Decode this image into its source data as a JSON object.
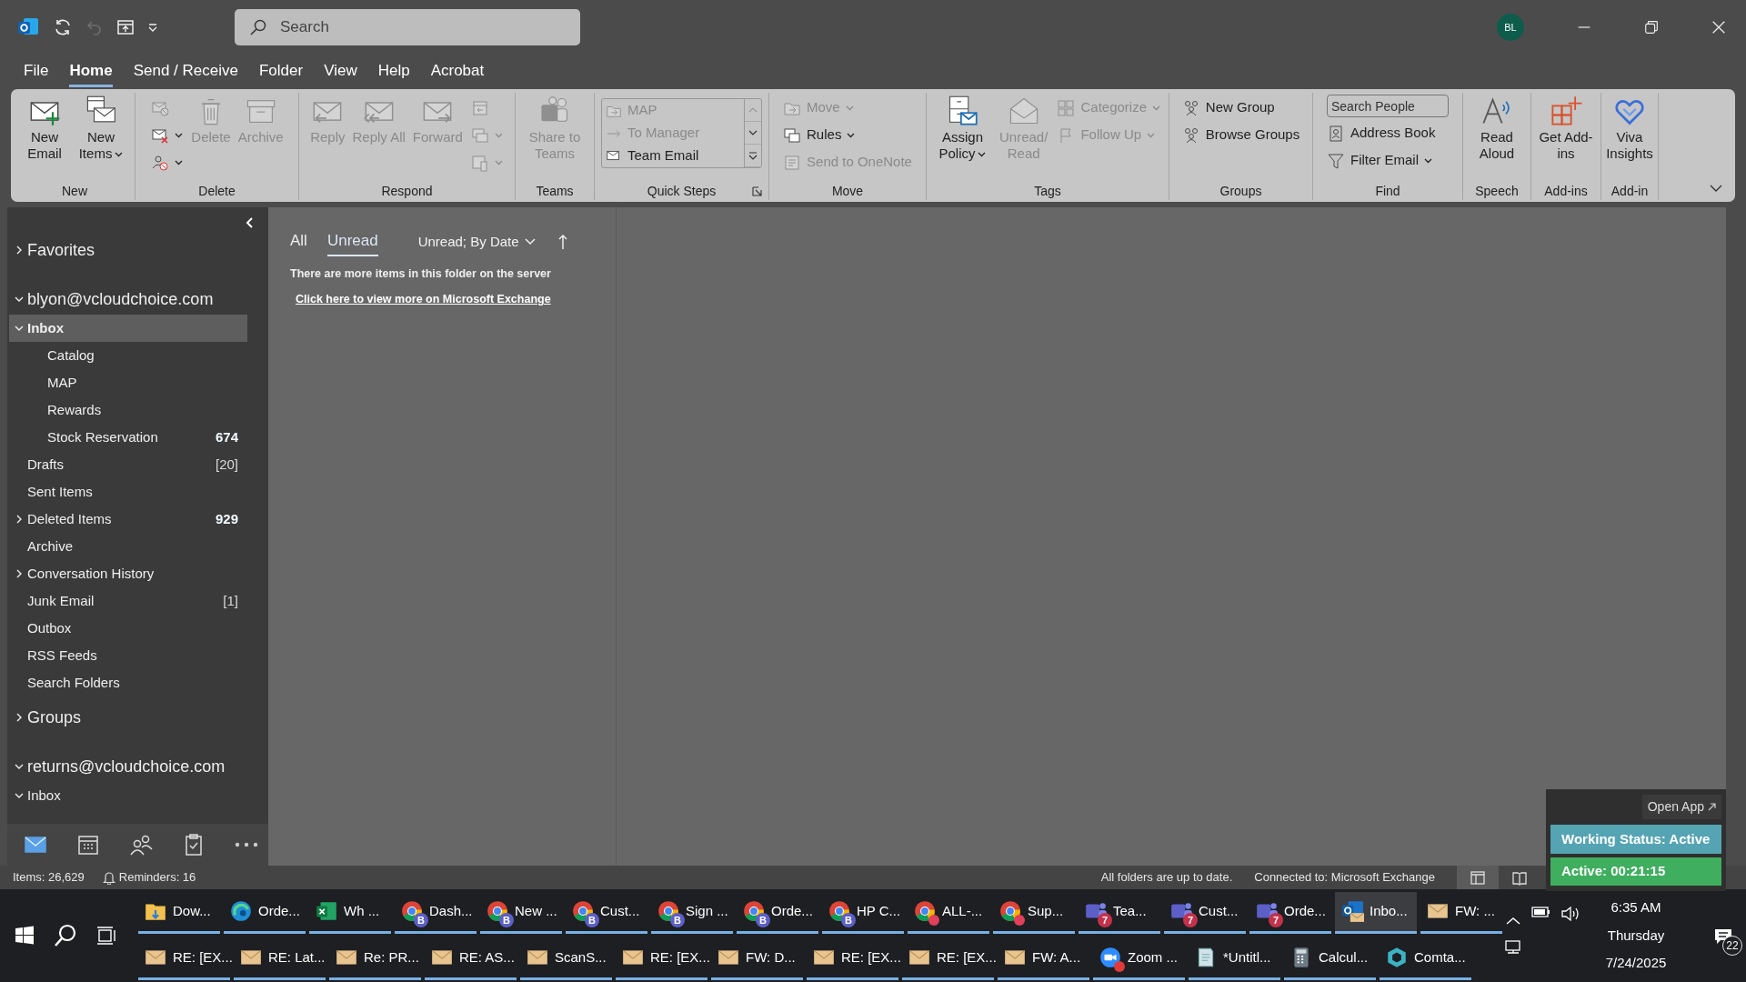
{
  "title_bar": {
    "search_placeholder": "Search",
    "avatar": "BL"
  },
  "menu_tabs": [
    {
      "label": "File",
      "selected": false
    },
    {
      "label": "Home",
      "selected": true
    },
    {
      "label": "Send / Receive",
      "selected": false
    },
    {
      "label": "Folder",
      "selected": false
    },
    {
      "label": "View",
      "selected": false
    },
    {
      "label": "Help",
      "selected": false
    },
    {
      "label": "Acrobat",
      "selected": false
    }
  ],
  "ribbon": {
    "groups": [
      {
        "label": "New",
        "launcher": false,
        "columns": [
          {
            "kind": "large",
            "label": "New Email",
            "disabled": false,
            "dropdown": false
          },
          {
            "kind": "large",
            "label": "New Items",
            "disabled": false,
            "dropdown": true
          }
        ]
      },
      {
        "label": "Delete",
        "launcher": false,
        "columns": [
          {
            "kind": "stack",
            "items": [
              {
                "disabled": true,
                "dropdown": false
              },
              {
                "disabled": false,
                "dropdown": true
              },
              {
                "disabled": false,
                "dropdown": true
              }
            ]
          },
          {
            "kind": "large",
            "label": "Delete",
            "disabled": true,
            "dropdown": false
          },
          {
            "kind": "large",
            "label": "Archive",
            "disabled": true,
            "dropdown": false
          }
        ]
      },
      {
        "label": "Respond",
        "launcher": false,
        "columns": [
          {
            "kind": "large",
            "label": "Reply",
            "disabled": true,
            "dropdown": false
          },
          {
            "kind": "large",
            "label": "Reply All",
            "disabled": true,
            "dropdown": false
          },
          {
            "kind": "large",
            "label": "Forward",
            "disabled": true,
            "dropdown": false
          },
          {
            "kind": "stack",
            "items": [
              {
                "disabled": true,
                "dropdown": false
              },
              {
                "disabled": true,
                "dropdown": true
              },
              {
                "disabled": true,
                "dropdown": true
              }
            ]
          }
        ]
      },
      {
        "label": "Teams",
        "launcher": false,
        "columns": [
          {
            "kind": "large",
            "label": "Share to Teams",
            "disabled": true,
            "dropdown": false
          }
        ]
      },
      {
        "label": "Quick Steps",
        "launcher": true,
        "columns": [
          {
            "kind": "gallery",
            "items": [
              {
                "label": "MAP",
                "disabled": true
              },
              {
                "label": "To Manager",
                "disabled": true
              },
              {
                "label": "Team Email",
                "disabled": false
              }
            ]
          }
        ]
      },
      {
        "label": "Move",
        "launcher": false,
        "columns": [
          {
            "kind": "stack",
            "items": [
              {
                "label": "Move",
                "disabled": true,
                "dropdown": true
              },
              {
                "label": "Rules",
                "disabled": false,
                "dropdown": true
              },
              {
                "label": "Send to OneNote",
                "disabled": true,
                "dropdown": false
              }
            ]
          }
        ]
      },
      {
        "label": "Tags",
        "launcher": false,
        "columns": [
          {
            "kind": "large",
            "label": "Assign Policy",
            "disabled": false,
            "dropdown": true
          },
          {
            "kind": "large",
            "label": "Unread/Read",
            "disabled": true,
            "dropdown": false
          },
          {
            "kind": "stack",
            "items": [
              {
                "label": "Categorize",
                "disabled": true,
                "dropdown": true
              },
              {
                "label": "Follow Up",
                "disabled": true,
                "dropdown": true
              }
            ]
          }
        ]
      },
      {
        "label": "Groups",
        "launcher": false,
        "columns": [
          {
            "kind": "stack",
            "items": [
              {
                "label": "New Group",
                "disabled": false,
                "dropdown": false
              },
              {
                "label": "Browse Groups",
                "disabled": false,
                "dropdown": false
              }
            ]
          }
        ]
      },
      {
        "label": "Find",
        "launcher": false,
        "columns": [
          {
            "kind": "stack",
            "items": [
              {
                "kind": "field",
                "placeholder": "Search People"
              },
              {
                "kind": "button",
                "label": "Address Book",
                "disabled": false,
                "dropdown": false
              },
              {
                "kind": "button",
                "label": "Filter Email",
                "disabled": false,
                "dropdown": true
              }
            ]
          }
        ]
      },
      {
        "label": "Speech",
        "launcher": false,
        "columns": [
          {
            "kind": "large",
            "label": "Read Aloud",
            "disabled": false,
            "dropdown": false
          }
        ]
      },
      {
        "label": "Add-ins",
        "launcher": false,
        "columns": [
          {
            "kind": "large",
            "label": "Get Add-ins",
            "disabled": false,
            "dropdown": false
          }
        ]
      },
      {
        "label": "Add-in",
        "launcher": false,
        "columns": [
          {
            "kind": "large",
            "label": "Viva Insights",
            "disabled": false,
            "dropdown": false
          }
        ]
      }
    ]
  },
  "folder_pane": {
    "sections": [
      {
        "kind": "header",
        "label": "Favorites",
        "expanded": false
      },
      {
        "kind": "account",
        "label": "blyon@vcloudchoice.com",
        "expanded": true,
        "folders": [
          {
            "label": "Inbox",
            "expanded": true,
            "selected": true,
            "children": [
              {
                "label": "Catalog",
                "selected": false
              },
              {
                "label": "MAP",
                "selected": false
              },
              {
                "label": "Rewards",
                "selected": false
              },
              {
                "label": "Stock Reservation",
                "selected": false,
                "count": "674",
                "count_bold": true
              }
            ]
          },
          {
            "label": "Drafts",
            "selected": false,
            "count": "[20]",
            "count_bold": false
          },
          {
            "label": "Sent Items",
            "selected": false
          },
          {
            "label": "Deleted Items",
            "expanded": false,
            "selected": false,
            "count": "929",
            "count_bold": true
          },
          {
            "label": "Archive",
            "selected": false
          },
          {
            "label": "Conversation History",
            "expanded": false,
            "selected": false
          },
          {
            "label": "Junk Email",
            "selected": false,
            "count": "[1]",
            "count_bold": false
          },
          {
            "label": "Outbox",
            "selected": false
          },
          {
            "label": "RSS Feeds",
            "selected": false
          },
          {
            "label": "Search Folders",
            "selected": false
          }
        ]
      },
      {
        "kind": "header",
        "label": "Groups",
        "expanded": false
      },
      {
        "kind": "account",
        "label": "returns@vcloudchoice.com",
        "expanded": true,
        "folders": [
          {
            "label": "Inbox",
            "expanded": true,
            "selected": false
          }
        ]
      }
    ]
  },
  "nav_bar": [
    {
      "selected": true
    },
    {
      "selected": false
    },
    {
      "selected": false
    },
    {
      "selected": false
    }
  ],
  "message_list": {
    "filters": [
      {
        "label": "All",
        "selected": false
      },
      {
        "label": "Unread",
        "selected": true
      }
    ],
    "sort": "Unread; By Date",
    "notice": "There are more items in this folder on the server",
    "link": "Click here to view more on Microsoft Exchange"
  },
  "status_widget": {
    "open_app": "Open App",
    "status": "Working Status: Active",
    "timer": "Active: 00:21:15"
  },
  "status_bar": {
    "items": "Items: 26,629",
    "reminders": "Reminders: 16",
    "sync": "All folders are up to date.",
    "connection": "Connected to: Microsoft Exchange",
    "views": [
      {
        "selected": true
      },
      {
        "selected": false
      }
    ]
  },
  "taskbar": {
    "rows": [
      {
        "apps": [
          {
            "kind": "folder",
            "label": "Dow...",
            "selected": false
          },
          {
            "kind": "edge",
            "label": "Orde...",
            "selected": false
          },
          {
            "kind": "excel",
            "label": "Wh ...",
            "selected": false
          },
          {
            "kind": "chrome",
            "label": "Dash...",
            "badge": "B",
            "selected": false
          },
          {
            "kind": "chrome",
            "label": "New ...",
            "badge": "B",
            "selected": false
          },
          {
            "kind": "chrome",
            "label": "Cust...",
            "badge": "B",
            "selected": false
          },
          {
            "kind": "chrome",
            "label": "Sign ...",
            "badge": "B",
            "selected": false
          },
          {
            "kind": "chrome",
            "label": "Orde...",
            "badge": "B",
            "selected": false
          },
          {
            "kind": "chrome",
            "label": "HP C...",
            "badge": "B",
            "selected": false
          },
          {
            "kind": "chrome",
            "label": "ALL-...",
            "color": "#e0405a",
            "selected": false
          },
          {
            "kind": "chrome",
            "label": "Sup...",
            "color": "#e0405a",
            "selected": false
          },
          {
            "kind": "teams",
            "label": "Tea...",
            "badge": "7",
            "selected": false
          },
          {
            "kind": "teams",
            "label": "Cust...",
            "badge": "7",
            "selected": false
          },
          {
            "kind": "teams",
            "label": "Orde...",
            "badge": "7",
            "selected": false
          },
          {
            "kind": "outlook",
            "label": "Inbo...",
            "selected": true
          },
          {
            "kind": "mail",
            "label": "FW: ...",
            "selected": false
          }
        ]
      },
      {
        "apps": [
          {
            "kind": "mail",
            "label": "RE: [EX...",
            "selected": false
          },
          {
            "kind": "mail",
            "label": "RE: Lat...",
            "selected": false
          },
          {
            "kind": "mail",
            "label": "Re: PR...",
            "selected": false
          },
          {
            "kind": "mail",
            "label": "RE: AS...",
            "selected": false
          },
          {
            "kind": "mail",
            "label": "ScanS...",
            "selected": false
          },
          {
            "kind": "mail",
            "label": "RE: [EX...",
            "selected": false
          },
          {
            "kind": "mail",
            "label": "FW: D...",
            "selected": false
          },
          {
            "kind": "mail",
            "label": "RE: [EX...",
            "selected": false
          },
          {
            "kind": "mail",
            "label": "RE: [EX...",
            "selected": false
          },
          {
            "kind": "mail",
            "label": "FW: A...",
            "selected": false
          },
          {
            "kind": "zoom",
            "label": "Zoom ...",
            "color": "#e03a3a",
            "selected": false
          },
          {
            "kind": "notepad",
            "label": "*Untitl...",
            "selected": false
          },
          {
            "kind": "calculator",
            "label": "Calcul...",
            "selected": false
          },
          {
            "kind": "hexagon",
            "label": "Comta...",
            "selected": false
          }
        ]
      }
    ],
    "tray": {
      "time": "6:35 AM",
      "day": "Thursday",
      "date": "7/24/2025",
      "notifications": "22"
    }
  }
}
